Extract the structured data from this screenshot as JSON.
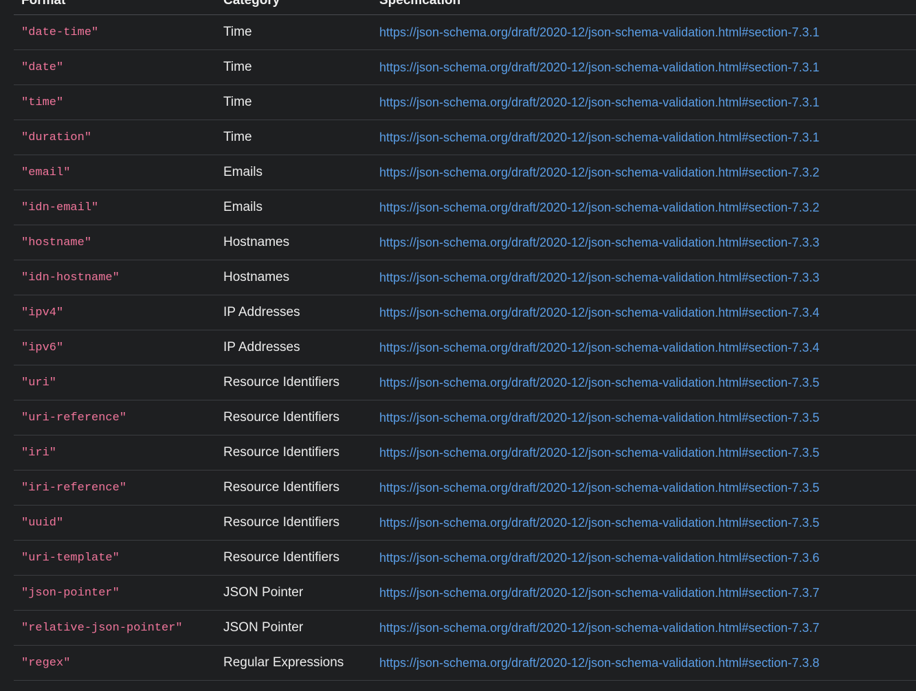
{
  "table": {
    "headers": {
      "format": "Format",
      "category": "Category",
      "specification": "Specification"
    },
    "rows": [
      {
        "format": "\"date-time\"",
        "category": "Time",
        "spec": "https://json-schema.org/draft/2020-12/json-schema-validation.html#section-7.3.1"
      },
      {
        "format": "\"date\"",
        "category": "Time",
        "spec": "https://json-schema.org/draft/2020-12/json-schema-validation.html#section-7.3.1"
      },
      {
        "format": "\"time\"",
        "category": "Time",
        "spec": "https://json-schema.org/draft/2020-12/json-schema-validation.html#section-7.3.1"
      },
      {
        "format": "\"duration\"",
        "category": "Time",
        "spec": "https://json-schema.org/draft/2020-12/json-schema-validation.html#section-7.3.1"
      },
      {
        "format": "\"email\"",
        "category": "Emails",
        "spec": "https://json-schema.org/draft/2020-12/json-schema-validation.html#section-7.3.2"
      },
      {
        "format": "\"idn-email\"",
        "category": "Emails",
        "spec": "https://json-schema.org/draft/2020-12/json-schema-validation.html#section-7.3.2"
      },
      {
        "format": "\"hostname\"",
        "category": "Hostnames",
        "spec": "https://json-schema.org/draft/2020-12/json-schema-validation.html#section-7.3.3"
      },
      {
        "format": "\"idn-hostname\"",
        "category": "Hostnames",
        "spec": "https://json-schema.org/draft/2020-12/json-schema-validation.html#section-7.3.3"
      },
      {
        "format": "\"ipv4\"",
        "category": "IP Addresses",
        "spec": "https://json-schema.org/draft/2020-12/json-schema-validation.html#section-7.3.4"
      },
      {
        "format": "\"ipv6\"",
        "category": "IP Addresses",
        "spec": "https://json-schema.org/draft/2020-12/json-schema-validation.html#section-7.3.4"
      },
      {
        "format": "\"uri\"",
        "category": "Resource Identifiers",
        "spec": "https://json-schema.org/draft/2020-12/json-schema-validation.html#section-7.3.5"
      },
      {
        "format": "\"uri-reference\"",
        "category": "Resource Identifiers",
        "spec": "https://json-schema.org/draft/2020-12/json-schema-validation.html#section-7.3.5"
      },
      {
        "format": "\"iri\"",
        "category": "Resource Identifiers",
        "spec": "https://json-schema.org/draft/2020-12/json-schema-validation.html#section-7.3.5"
      },
      {
        "format": "\"iri-reference\"",
        "category": "Resource Identifiers",
        "spec": "https://json-schema.org/draft/2020-12/json-schema-validation.html#section-7.3.5"
      },
      {
        "format": "\"uuid\"",
        "category": "Resource Identifiers",
        "spec": "https://json-schema.org/draft/2020-12/json-schema-validation.html#section-7.3.5"
      },
      {
        "format": "\"uri-template\"",
        "category": "Resource Identifiers",
        "spec": "https://json-schema.org/draft/2020-12/json-schema-validation.html#section-7.3.6"
      },
      {
        "format": "\"json-pointer\"",
        "category": "JSON Pointer",
        "spec": "https://json-schema.org/draft/2020-12/json-schema-validation.html#section-7.3.7"
      },
      {
        "format": "\"relative-json-pointer\"",
        "category": "JSON Pointer",
        "spec": "https://json-schema.org/draft/2020-12/json-schema-validation.html#section-7.3.7"
      },
      {
        "format": "\"regex\"",
        "category": "Regular Expressions",
        "spec": "https://json-schema.org/draft/2020-12/json-schema-validation.html#section-7.3.8"
      }
    ]
  },
  "colors": {
    "background": "#1e1f21",
    "format_text": "#f0759b",
    "link": "#5b9ee6",
    "row_divider": "#3b3d41"
  }
}
